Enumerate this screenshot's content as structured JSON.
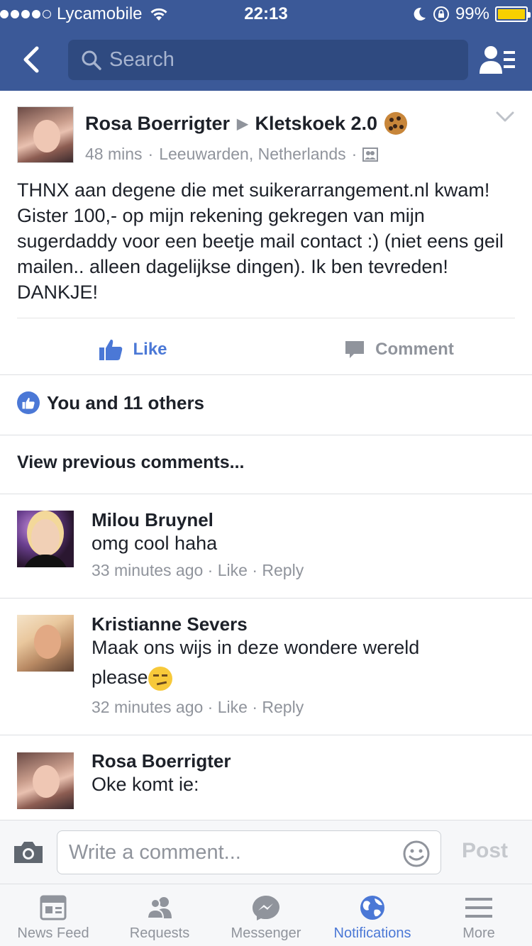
{
  "status_bar": {
    "carrier": "Lycamobile",
    "time": "22:13",
    "battery": "99%",
    "battery_level": 0.99,
    "signal_bars": 4
  },
  "nav": {
    "search_placeholder": "Search",
    "icons": [
      "back-arrow-icon",
      "search-icon",
      "friends-list-icon"
    ]
  },
  "post": {
    "author": "Rosa Boerrigter",
    "group": "Kletskoek 2.0",
    "time": "48 mins",
    "location": "Leeuwarden, Netherlands",
    "separator": "·",
    "text": "THNX aan degene die met suikerarrangement.nl kwam! Gister 100,- op mijn rekening gekregen van mijn sugerdaddy voor een beetje mail contact :) (niet eens geil mailen.. alleen dagelijkse dingen). Ik ben tevreden! DANKJE!",
    "like_label": "Like",
    "comment_label": "Comment"
  },
  "likes": {
    "text": "You and 11 others"
  },
  "view_previous": "View previous comments...",
  "comments": [
    {
      "name": "Milou Bruynel",
      "text": "omg cool haha",
      "time": "33 minutes ago",
      "like": "Like",
      "reply": "Reply"
    },
    {
      "name": "Kristianne Severs",
      "text_line1": "Maak ons wijs in deze wondere wereld",
      "text_line2": "please",
      "time": "32 minutes ago",
      "like": "Like",
      "reply": "Reply"
    },
    {
      "name": "Rosa Boerrigter",
      "text": "Oke komt ie:"
    }
  ],
  "composer": {
    "placeholder": "Write a comment...",
    "post_label": "Post"
  },
  "tabs": [
    {
      "label": "News Feed",
      "icon": "news-feed-icon"
    },
    {
      "label": "Requests",
      "icon": "requests-icon"
    },
    {
      "label": "Messenger",
      "icon": "messenger-icon"
    },
    {
      "label": "Notifications",
      "icon": "globe-icon",
      "active": true
    },
    {
      "label": "More",
      "icon": "menu-icon"
    }
  ],
  "colors": {
    "brand": "#3b5998",
    "accent": "#4b78d6",
    "muted": "#90949c"
  }
}
